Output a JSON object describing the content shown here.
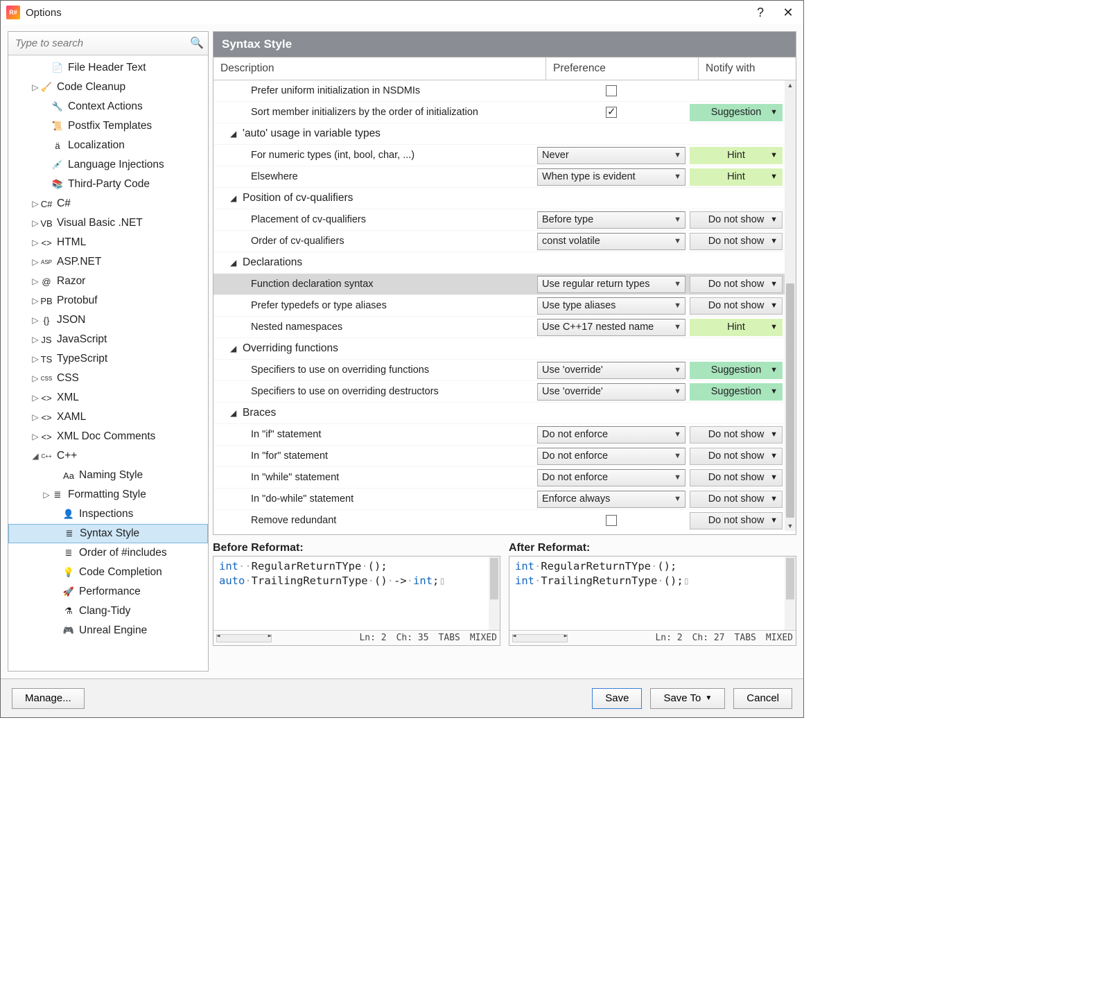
{
  "window": {
    "title": "Options"
  },
  "search": {
    "placeholder": "Type to search"
  },
  "tree": [
    {
      "depth": 2,
      "arrow": "",
      "icon": "📄",
      "label": "File Header Text"
    },
    {
      "depth": 1,
      "arrow": "▷",
      "icon": "🧹",
      "label": "Code Cleanup"
    },
    {
      "depth": 2,
      "arrow": "",
      "icon": "🔧",
      "label": "Context Actions"
    },
    {
      "depth": 2,
      "arrow": "",
      "icon": "📜",
      "label": "Postfix Templates"
    },
    {
      "depth": 2,
      "arrow": "",
      "icon": "ä",
      "label": "Localization"
    },
    {
      "depth": 2,
      "arrow": "",
      "icon": "💉",
      "label": "Language Injections"
    },
    {
      "depth": 2,
      "arrow": "",
      "icon": "📚",
      "label": "Third-Party Code"
    },
    {
      "depth": 1,
      "arrow": "▷",
      "icon": "C#",
      "label": "C#"
    },
    {
      "depth": 1,
      "arrow": "▷",
      "icon": "VB",
      "label": "Visual Basic .NET"
    },
    {
      "depth": 1,
      "arrow": "▷",
      "icon": "<>",
      "label": "HTML"
    },
    {
      "depth": 1,
      "arrow": "▷",
      "icon": "ASP",
      "label": "ASP.NET"
    },
    {
      "depth": 1,
      "arrow": "▷",
      "icon": "@",
      "label": "Razor"
    },
    {
      "depth": 1,
      "arrow": "▷",
      "icon": "PB",
      "label": "Protobuf"
    },
    {
      "depth": 1,
      "arrow": "▷",
      "icon": "{}",
      "label": "JSON"
    },
    {
      "depth": 1,
      "arrow": "▷",
      "icon": "JS",
      "label": "JavaScript"
    },
    {
      "depth": 1,
      "arrow": "▷",
      "icon": "TS",
      "label": "TypeScript"
    },
    {
      "depth": 1,
      "arrow": "▷",
      "icon": "CSS",
      "label": "CSS"
    },
    {
      "depth": 1,
      "arrow": "▷",
      "icon": "<>",
      "label": "XML"
    },
    {
      "depth": 1,
      "arrow": "▷",
      "icon": "<>",
      "label": "XAML"
    },
    {
      "depth": 1,
      "arrow": "▷",
      "icon": "<>",
      "label": "XML Doc Comments"
    },
    {
      "depth": 1,
      "arrow": "◢",
      "icon": "C++",
      "label": "C++"
    },
    {
      "depth": 3,
      "arrow": "",
      "icon": "Aa",
      "label": "Naming Style"
    },
    {
      "depth": 2,
      "arrow": "▷",
      "icon": "≣",
      "label": "Formatting Style"
    },
    {
      "depth": 3,
      "arrow": "",
      "icon": "👤",
      "label": "Inspections"
    },
    {
      "depth": 3,
      "arrow": "",
      "icon": "≣",
      "label": "Syntax Style",
      "selected": true
    },
    {
      "depth": 3,
      "arrow": "",
      "icon": "≣",
      "label": "Order of #includes"
    },
    {
      "depth": 3,
      "arrow": "",
      "icon": "💡",
      "label": "Code Completion"
    },
    {
      "depth": 3,
      "arrow": "",
      "icon": "🚀",
      "label": "Performance"
    },
    {
      "depth": 3,
      "arrow": "",
      "icon": "⚗",
      "label": "Clang-Tidy"
    },
    {
      "depth": 3,
      "arrow": "",
      "icon": "🎮",
      "label": "Unreal Engine"
    }
  ],
  "panel": {
    "title": "Syntax Style"
  },
  "grid": {
    "headers": {
      "desc": "Description",
      "pref": "Preference",
      "notify": "Notify with"
    },
    "rows": [
      {
        "type": "item",
        "desc": "Prefer uniform initialization in NSDMIs",
        "pref": {
          "kind": "check",
          "checked": false
        }
      },
      {
        "type": "item",
        "desc": "Sort member initializers by the order of initialization",
        "pref": {
          "kind": "check",
          "checked": true
        },
        "notify": {
          "level": "suggestion",
          "label": "Suggestion"
        }
      },
      {
        "type": "group",
        "desc": "'auto' usage in variable types"
      },
      {
        "type": "item",
        "desc": "For numeric types (int, bool, char, ...)",
        "pref": {
          "kind": "combo",
          "value": "Never"
        },
        "notify": {
          "level": "hint",
          "label": "Hint"
        }
      },
      {
        "type": "item",
        "desc": "Elsewhere",
        "pref": {
          "kind": "combo",
          "value": "When type is evident"
        },
        "notify": {
          "level": "hint",
          "label": "Hint"
        }
      },
      {
        "type": "group",
        "desc": "Position of cv-qualifiers"
      },
      {
        "type": "item",
        "desc": "Placement of cv-qualifiers",
        "pref": {
          "kind": "combo",
          "value": "Before type"
        },
        "notify": {
          "level": "none",
          "label": "Do not show"
        }
      },
      {
        "type": "item",
        "desc": "Order of cv-qualifiers",
        "pref": {
          "kind": "combo",
          "value": "const volatile"
        },
        "notify": {
          "level": "none",
          "label": "Do not show"
        }
      },
      {
        "type": "group",
        "desc": "Declarations"
      },
      {
        "type": "item",
        "desc": "Function declaration syntax",
        "pref": {
          "kind": "combo",
          "value": "Use regular return types"
        },
        "notify": {
          "level": "none",
          "label": "Do not show"
        },
        "selected": true
      },
      {
        "type": "item",
        "desc": "Prefer typedefs or type aliases",
        "pref": {
          "kind": "combo",
          "value": "Use type aliases"
        },
        "notify": {
          "level": "none",
          "label": "Do not show"
        }
      },
      {
        "type": "item",
        "desc": "Nested namespaces",
        "pref": {
          "kind": "combo",
          "value": "Use C++17 nested name"
        },
        "notify": {
          "level": "hint",
          "label": "Hint"
        }
      },
      {
        "type": "group",
        "desc": "Overriding functions"
      },
      {
        "type": "item",
        "desc": "Specifiers to use on overriding functions",
        "pref": {
          "kind": "combo",
          "value": "Use 'override'"
        },
        "notify": {
          "level": "suggestion",
          "label": "Suggestion"
        }
      },
      {
        "type": "item",
        "desc": "Specifiers to use on overriding destructors",
        "pref": {
          "kind": "combo",
          "value": "Use 'override'"
        },
        "notify": {
          "level": "suggestion",
          "label": "Suggestion"
        }
      },
      {
        "type": "group",
        "desc": "Braces"
      },
      {
        "type": "item",
        "desc": "In \"if\" statement",
        "pref": {
          "kind": "combo",
          "value": "Do not enforce"
        },
        "notify": {
          "level": "none",
          "label": "Do not show"
        }
      },
      {
        "type": "item",
        "desc": "In \"for\" statement",
        "pref": {
          "kind": "combo",
          "value": "Do not enforce"
        },
        "notify": {
          "level": "none",
          "label": "Do not show"
        }
      },
      {
        "type": "item",
        "desc": "In \"while\" statement",
        "pref": {
          "kind": "combo",
          "value": "Do not enforce"
        },
        "notify": {
          "level": "none",
          "label": "Do not show"
        }
      },
      {
        "type": "item",
        "desc": "In \"do-while\" statement",
        "pref": {
          "kind": "combo",
          "value": "Enforce always"
        },
        "notify": {
          "level": "none",
          "label": "Do not show"
        }
      },
      {
        "type": "item",
        "desc": "Remove redundant",
        "pref": {
          "kind": "check",
          "checked": false
        },
        "notify": {
          "level": "none",
          "label": "Do not show"
        }
      }
    ]
  },
  "preview": {
    "before": {
      "title": "Before Reformat:",
      "status": {
        "ln": "Ln: 2",
        "ch": "Ch: 35",
        "tabs": "TABS",
        "enc": "MIXED"
      }
    },
    "after": {
      "title": "After Reformat:",
      "status": {
        "ln": "Ln: 2",
        "ch": "Ch: 27",
        "tabs": "TABS",
        "enc": "MIXED"
      }
    }
  },
  "footer": {
    "manage": "Manage...",
    "save": "Save",
    "saveto": "Save To",
    "cancel": "Cancel"
  }
}
